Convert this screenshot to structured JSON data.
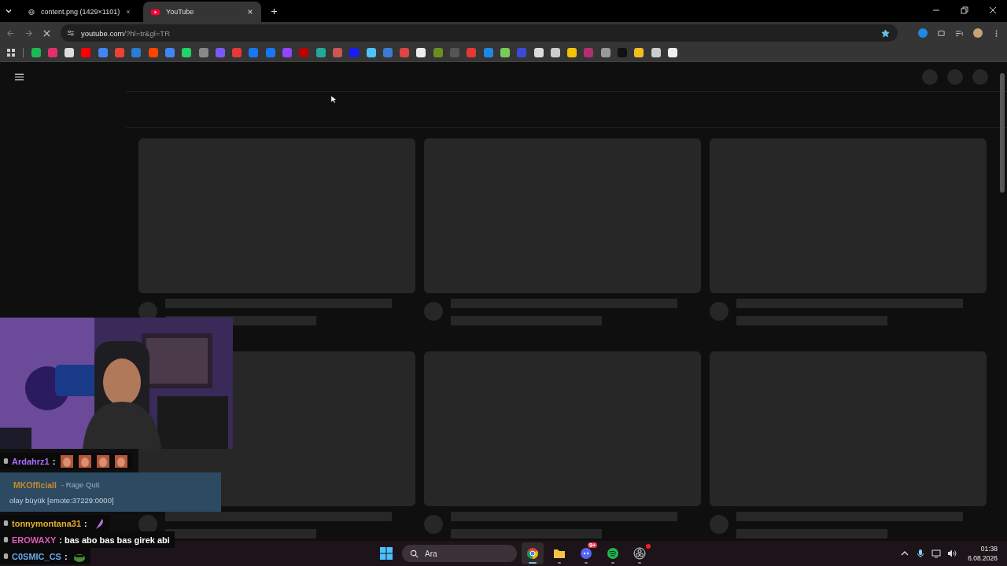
{
  "browser": {
    "tabs": [
      {
        "title": "content.png (1429×1101)",
        "selected": false,
        "kind": "globe"
      },
      {
        "title": "YouTube",
        "selected": true,
        "kind": "youtube"
      }
    ],
    "address": {
      "host": "youtube.com",
      "path": "/?hl=tr&gl=TR"
    },
    "loading": true,
    "bookmarked": true
  },
  "chat": [
    {
      "kind": "message",
      "user": "Ardahrz1",
      "color": "#a970ff",
      "text": ":",
      "emotes": [
        {
          "kind": "face"
        },
        {
          "kind": "face"
        },
        {
          "kind": "face"
        },
        {
          "kind": "face"
        }
      ]
    },
    {
      "kind": "highlight",
      "user": "MKOfficiall",
      "color": "#c98a2b",
      "reward": "- Rage Quit",
      "text": "olay büyük [emote:37229:0000]"
    },
    {
      "kind": "message",
      "user": "tonnymontana31",
      "color": "#e8b12a",
      "text": ":",
      "emotes": [
        {
          "kind": "feather"
        }
      ]
    },
    {
      "kind": "message",
      "user": "EROWAXY",
      "color": "#e05bb5",
      "text": ": bas abo bas bas girek abi"
    },
    {
      "kind": "message",
      "user": "C0SMIC_CS",
      "color": "#6aa7e8",
      "text": ":",
      "emotes": [
        {
          "kind": "frog"
        }
      ]
    }
  ],
  "taskbar": {
    "search_placeholder": "Ara",
    "apps": [
      {
        "kind": "chrome",
        "selected": true
      },
      {
        "kind": "folder",
        "selected": false
      },
      {
        "kind": "discord",
        "selected": false,
        "badge": "9+"
      },
      {
        "kind": "spotify",
        "selected": false
      },
      {
        "kind": "obs",
        "selected": false
      }
    ],
    "time": "01:38",
    "date": "6.08.2026"
  }
}
